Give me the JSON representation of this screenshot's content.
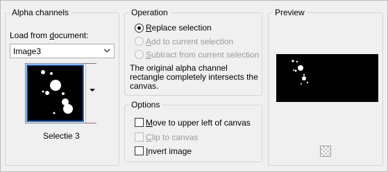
{
  "alpha_channels": {
    "title": "Alpha channels",
    "load_label_pre": "Load from ",
    "load_label_u": "d",
    "load_label_post": "ocument:",
    "document_value": "Image3",
    "thumbnail_caption": "Selectie 3"
  },
  "operation": {
    "title": "Operation",
    "options": [
      {
        "pre": "",
        "u": "R",
        "post": "eplace selection",
        "checked": true,
        "enabled": true
      },
      {
        "pre": "",
        "u": "A",
        "post": "dd to current selection",
        "checked": false,
        "enabled": false
      },
      {
        "pre": "",
        "u": "S",
        "post": "ubtract from current selection",
        "checked": false,
        "enabled": false
      }
    ],
    "message_lines": [
      "The original alpha channel",
      "rectangle completely intersects the",
      "canvas."
    ]
  },
  "options_group": {
    "title": "Options",
    "items": [
      {
        "pre": "",
        "u": "M",
        "post": "ove to upper left of canvas",
        "enabled": true
      },
      {
        "pre": "",
        "u": "C",
        "post": "lip to canvas",
        "enabled": false
      },
      {
        "pre": "",
        "u": "I",
        "post": "nvert image",
        "enabled": true
      }
    ]
  },
  "preview": {
    "title": "Preview",
    "transparency_icon": "checkerboard-icon"
  }
}
